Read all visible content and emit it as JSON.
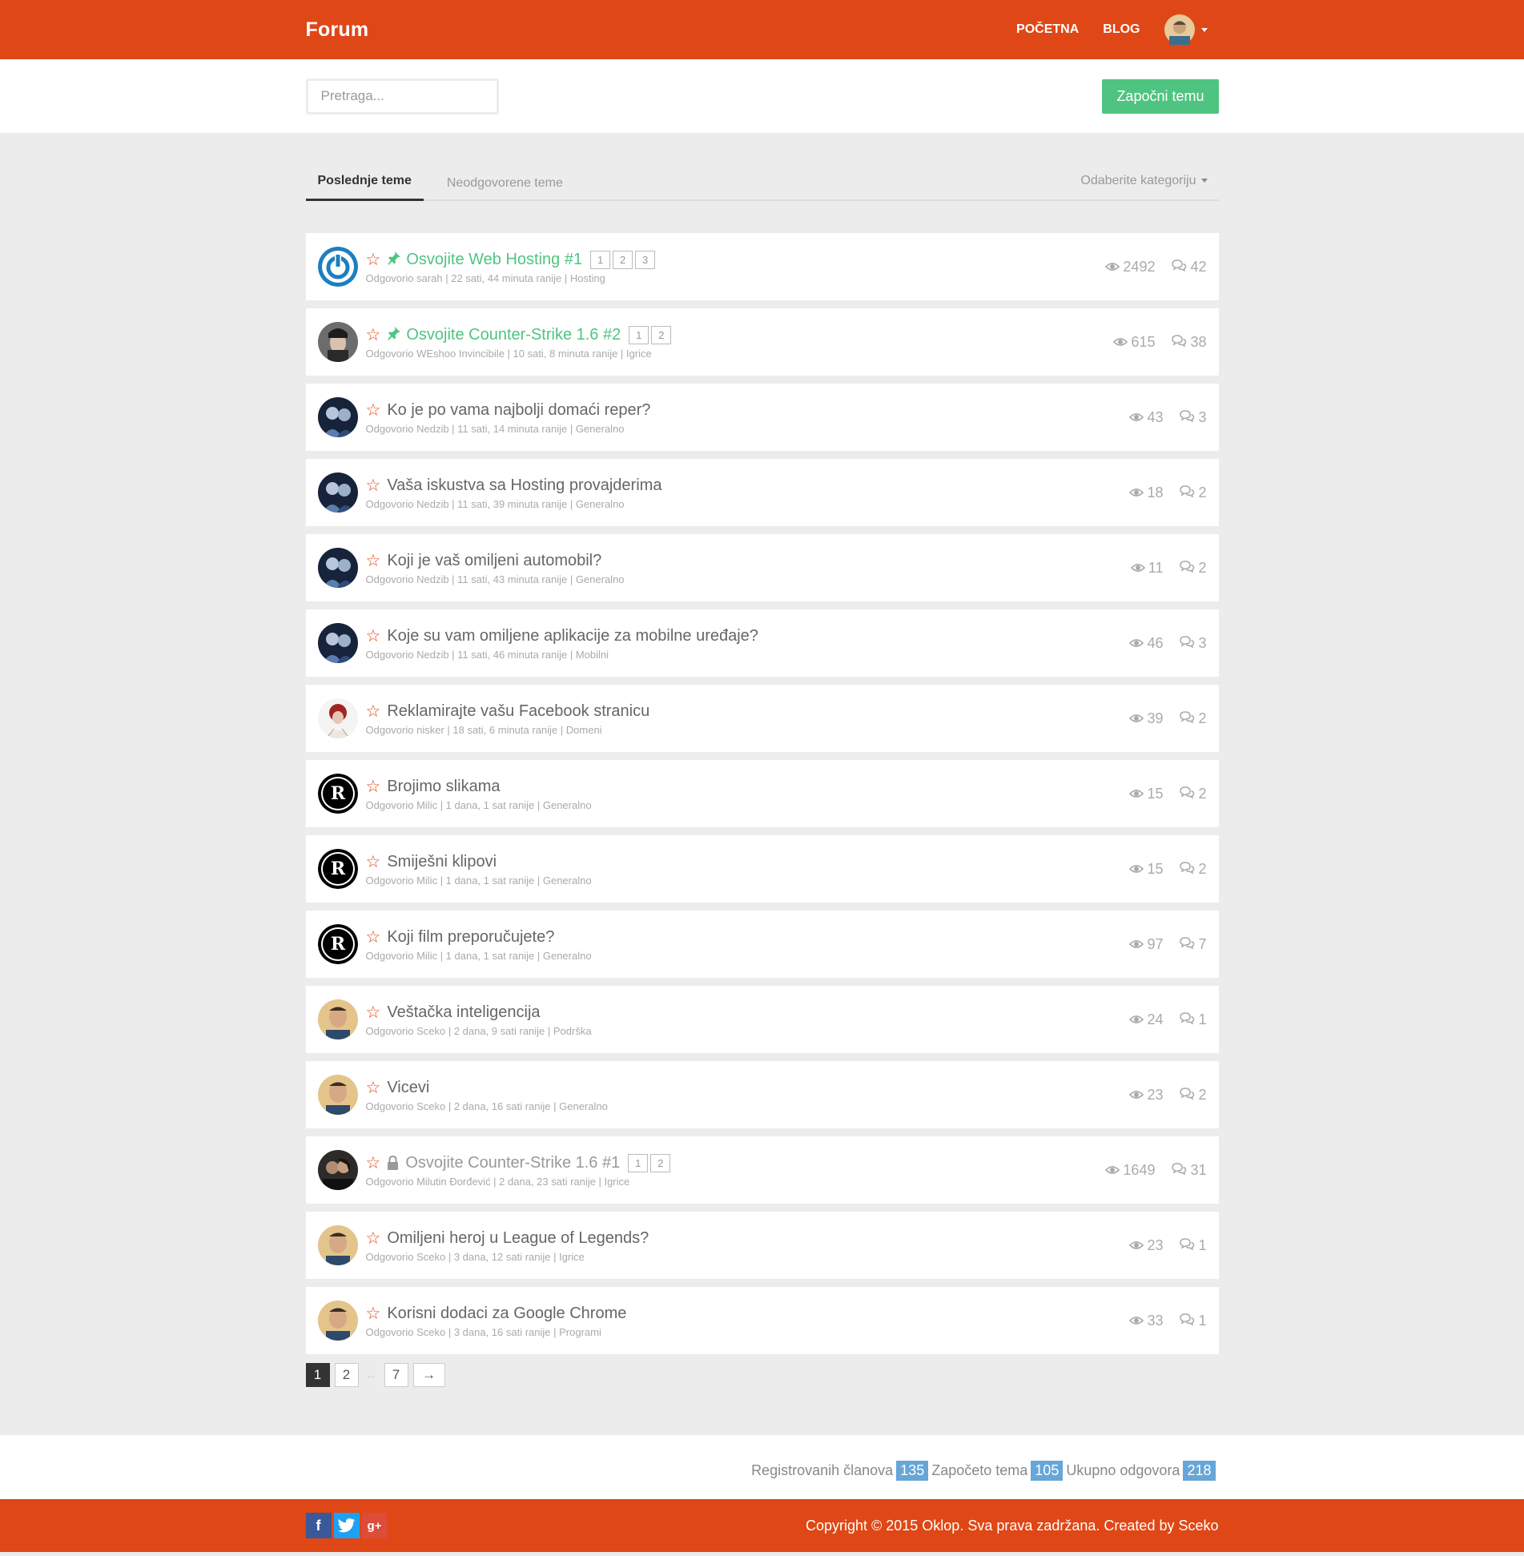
{
  "header": {
    "brand": "Forum",
    "nav": [
      "POČETNA",
      "BLOG"
    ],
    "accent": "#df4716"
  },
  "toolbar": {
    "search_placeholder": "Pretraga...",
    "new_topic": "Započni temu",
    "new_topic_color": "#4fc481"
  },
  "tabs": {
    "latest": "Poslednje teme",
    "unanswered": "Neodgovorene teme",
    "category": "Odaberite kategoriju"
  },
  "topics": [
    {
      "title": "Osvojite Web Hosting #1",
      "state": "pinned",
      "pages": [
        "1",
        "2",
        "3"
      ],
      "meta": "Odgovorio sarah | 22 sati, 44 minuta ranije | Hosting",
      "views": "2492",
      "replies": "42",
      "avatar": "power-logo"
    },
    {
      "title": "Osvojite Counter-Strike 1.6 #2",
      "state": "pinned",
      "pages": [
        "1",
        "2"
      ],
      "meta": "Odgovorio WEshoo Invincibile | 10 sati, 8 minuta ranije | Igrice",
      "views": "615",
      "replies": "38",
      "avatar": "photo-cap"
    },
    {
      "title": "Ko je po vama najbolji domaći reper?",
      "state": "normal",
      "pages": [],
      "meta": "Odgovorio Nedzib | 11 sati, 14 minuta ranije | Generalno",
      "views": "43",
      "replies": "3",
      "avatar": "photo-dark"
    },
    {
      "title": "Vaša iskustva sa Hosting provajderima",
      "state": "normal",
      "pages": [],
      "meta": "Odgovorio Nedzib | 11 sati, 39 minuta ranije | Generalno",
      "views": "18",
      "replies": "2",
      "avatar": "photo-dark"
    },
    {
      "title": "Koji je vaš omiljeni automobil?",
      "state": "normal",
      "pages": [],
      "meta": "Odgovorio Nedzib | 11 sati, 43 minuta ranije | Generalno",
      "views": "11",
      "replies": "2",
      "avatar": "photo-dark"
    },
    {
      "title": "Koje su vam omiljene aplikacije za mobilne uređaje?",
      "state": "normal",
      "pages": [],
      "meta": "Odgovorio Nedzib | 11 sati, 46 minuta ranije | Mobilni",
      "views": "46",
      "replies": "3",
      "avatar": "photo-dark"
    },
    {
      "title": "Reklamirajte vašu Facebook stranicu",
      "state": "normal",
      "pages": [],
      "meta": "Odgovorio nisker | 18 sati, 6 minuta ranije | Domeni",
      "views": "39",
      "replies": "2",
      "avatar": "photo-red-hair"
    },
    {
      "title": "Brojimo slikama",
      "state": "normal",
      "pages": [],
      "meta": "Odgovorio Milic | 1 dana, 1 sat ranije | Generalno",
      "views": "15",
      "replies": "2",
      "avatar": "r-logo"
    },
    {
      "title": "Smiješni klipovi",
      "state": "normal",
      "pages": [],
      "meta": "Odgovorio Milic | 1 dana, 1 sat ranije | Generalno",
      "views": "15",
      "replies": "2",
      "avatar": "r-logo"
    },
    {
      "title": "Koji film preporučujete?",
      "state": "normal",
      "pages": [],
      "meta": "Odgovorio Milic | 1 dana, 1 sat ranije | Generalno",
      "views": "97",
      "replies": "7",
      "avatar": "r-logo"
    },
    {
      "title": "Veštačka inteligencija",
      "state": "normal",
      "pages": [],
      "meta": "Odgovorio Sceko | 2 dana, 9 sati ranije | Podrška",
      "views": "24",
      "replies": "1",
      "avatar": "photo-sceko"
    },
    {
      "title": "Vicevi",
      "state": "normal",
      "pages": [],
      "meta": "Odgovorio Sceko | 2 dana, 16 sati ranije | Generalno",
      "views": "23",
      "replies": "2",
      "avatar": "photo-sceko"
    },
    {
      "title": "Osvojite Counter-Strike 1.6 #1",
      "state": "locked",
      "pages": [
        "1",
        "2"
      ],
      "meta": "Odgovorio Milutin Đorđević | 2 dana, 23 sati ranije | Igrice",
      "views": "1649",
      "replies": "31",
      "avatar": "photo-couple"
    },
    {
      "title": "Omiljeni heroj u League of Legends?",
      "state": "normal",
      "pages": [],
      "meta": "Odgovorio Sceko | 3 dana, 12 sati ranije | Igrice",
      "views": "23",
      "replies": "1",
      "avatar": "photo-sceko"
    },
    {
      "title": "Korisni dodaci za Google Chrome",
      "state": "normal",
      "pages": [],
      "meta": "Odgovorio Sceko | 3 dana, 16 sati ranije | Programi",
      "views": "33",
      "replies": "1",
      "avatar": "photo-sceko"
    }
  ],
  "pagination": {
    "current": "1",
    "pages": [
      "1",
      "2",
      "7"
    ],
    "dots": "...",
    "next": "→"
  },
  "site_stats": {
    "members_label": "Registrovanih članova",
    "members": "135",
    "topics_label": "Započeto tema",
    "topics": "105",
    "replies_label": "Ukupno odgovora",
    "replies": "218"
  },
  "footer": {
    "copyright": "Copyright © 2015 Oklop. Sva prava zadržana. Created by Sceko",
    "socials": [
      "facebook-icon",
      "twitter-icon",
      "google-plus-icon"
    ]
  }
}
